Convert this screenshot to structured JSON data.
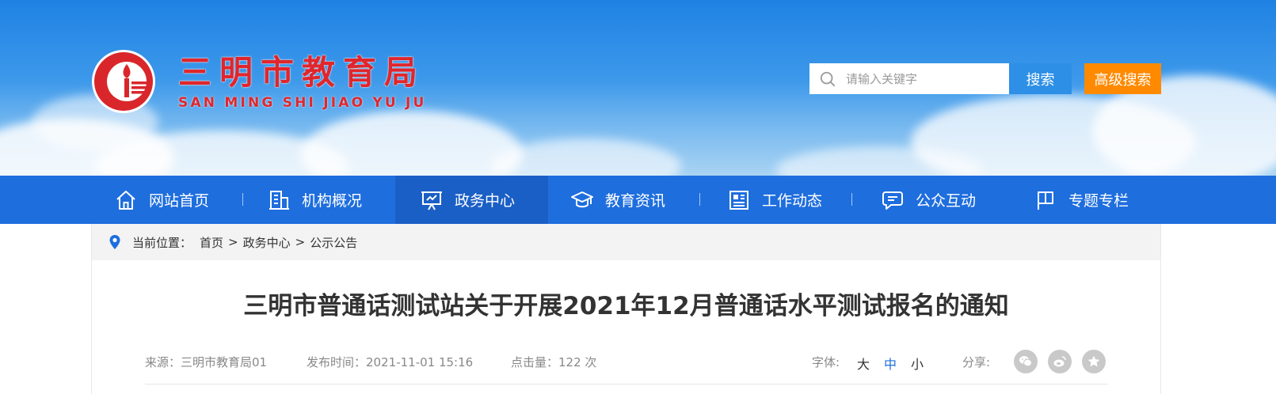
{
  "header": {
    "title": "三明市教育局",
    "subtitle": "SAN MING SHI JIAO YU JU",
    "search": {
      "placeholder": "请输入关键字",
      "value": ""
    },
    "search_button": "搜索",
    "advanced_search_button": "高级搜索"
  },
  "nav": {
    "items": [
      {
        "label": "网站首页",
        "icon": "home-icon"
      },
      {
        "label": "机构概况",
        "icon": "building-icon"
      },
      {
        "label": "政务中心",
        "icon": "presentation-icon",
        "active": true
      },
      {
        "label": "教育资讯",
        "icon": "graduation-cap-icon"
      },
      {
        "label": "工作动态",
        "icon": "newspaper-icon"
      },
      {
        "label": "公众互动",
        "icon": "chat-icon"
      },
      {
        "label": "专题专栏",
        "icon": "flag-icon"
      }
    ]
  },
  "breadcrumb": {
    "prefix": "当前位置：",
    "items": [
      "首页",
      "政务中心",
      "公示公告"
    ],
    "separator": ">"
  },
  "article": {
    "title": "三明市普通话测试站关于开展2021年12月普通话水平测试报名的通知",
    "source_label": "来源：",
    "source": "三明市教育局01",
    "date_label": "发布时间：",
    "date": "2021-11-01 15:16",
    "clicks_label": "点击量：",
    "clicks": "122 次",
    "font_label": "字体:",
    "font_sizes": [
      "大",
      "中",
      "小"
    ],
    "share_label": "分享:",
    "share_icons": [
      "wechat-icon",
      "weibo-icon",
      "favorite-star-icon"
    ]
  },
  "colors": {
    "nav_bg": "#1e6ede",
    "nav_active": "#1a5fc6",
    "title_red": "#e0262c",
    "search_blue": "#2d8fe6",
    "advanced_orange": "#ff8a00",
    "font_size_active": "#1e6ede"
  }
}
